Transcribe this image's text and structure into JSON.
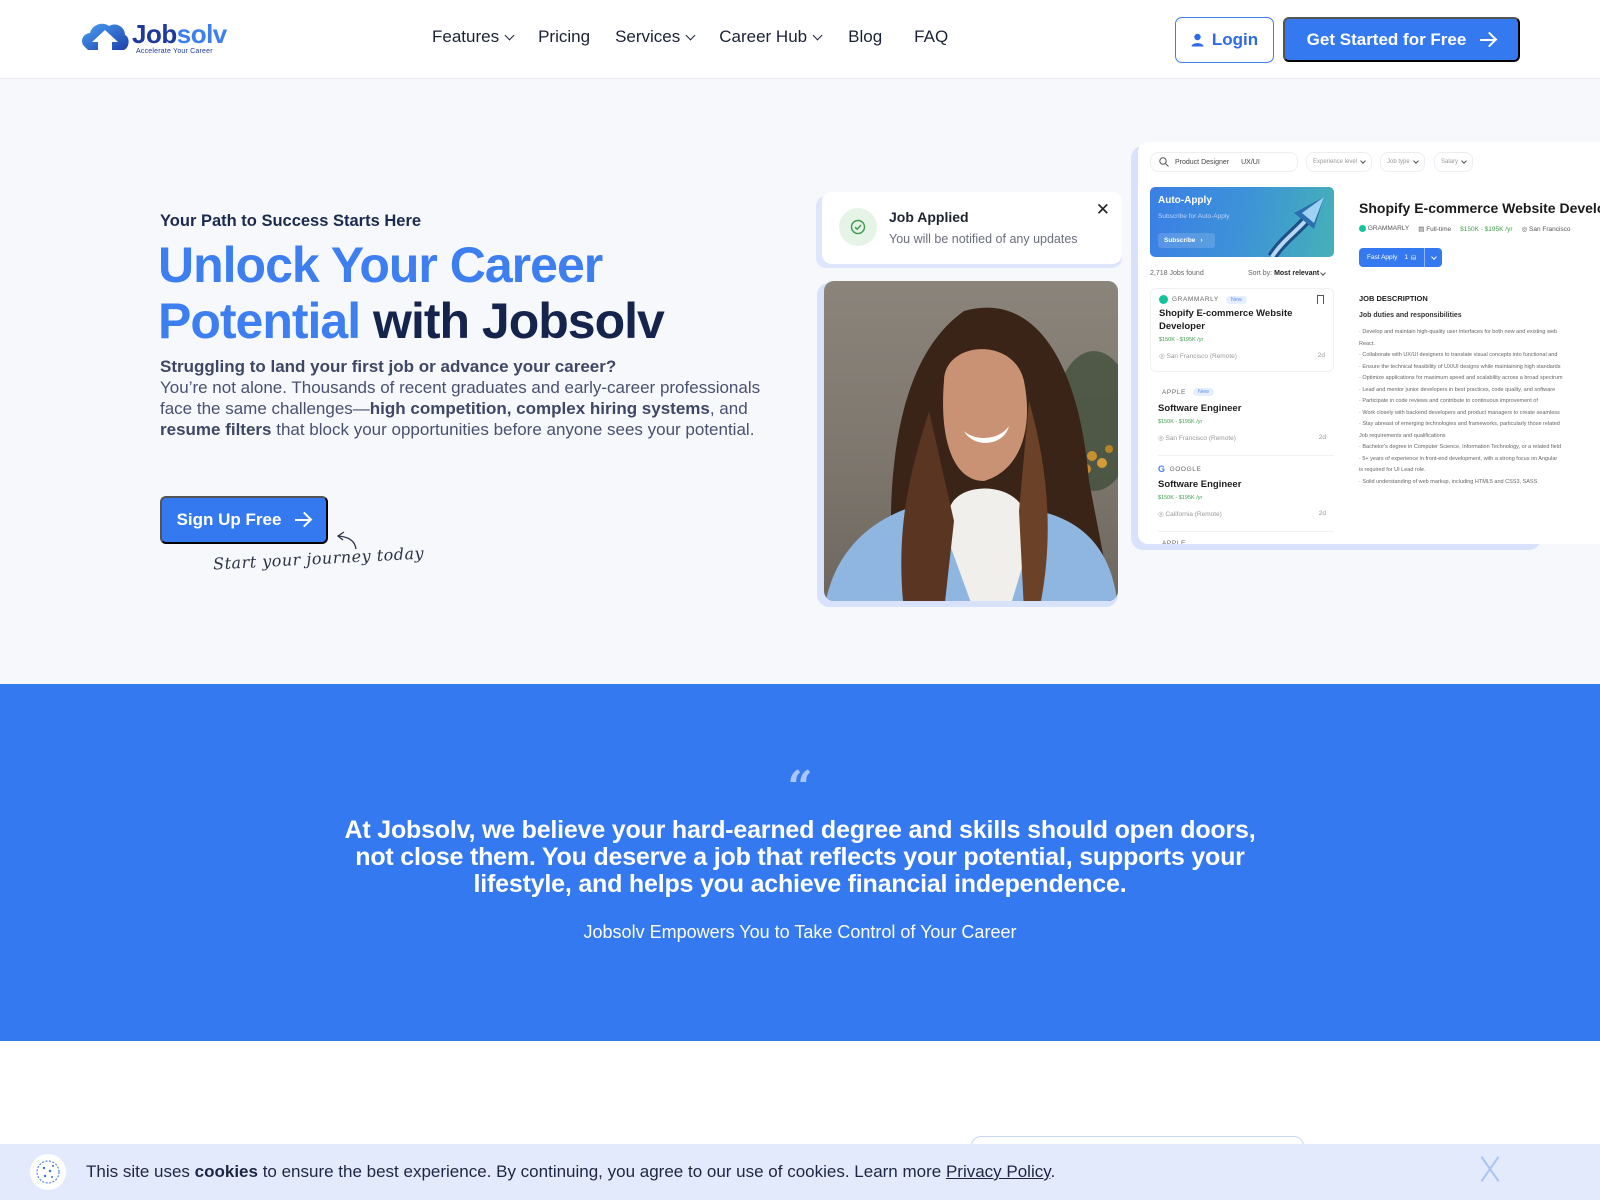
{
  "header": {
    "logo": {
      "word_part1": "Job",
      "word_part2": "solv",
      "tagline": "Accelerate Your Career"
    },
    "nav": [
      {
        "label": "Features",
        "has_dropdown": true
      },
      {
        "label": "Pricing",
        "has_dropdown": false
      },
      {
        "label": "Services",
        "has_dropdown": true
      },
      {
        "label": "Career Hub",
        "has_dropdown": true
      },
      {
        "label": "Blog",
        "has_dropdown": false
      },
      {
        "label": "FAQ",
        "has_dropdown": false
      }
    ],
    "login_label": "Login",
    "cta_label": "Get Started for Free"
  },
  "hero": {
    "eyebrow": "Your Path to Success Starts Here",
    "headline_blue": "Unlock Your Career Potential",
    "headline_dark": "with Jobsolv",
    "body_lead": "Struggling to land your first job or advance your career?",
    "body_part1": "You’re not alone. Thousands of recent graduates and early-career professionals face the same challenges—",
    "body_bold1": "high competition, complex hiring systems",
    "body_part2": ", and ",
    "body_bold2": "resume filters",
    "body_part3": " that block your opportunities before anyone sees your potential.",
    "signup_label": "Sign Up Free",
    "handwritten_note": "Start your journey today"
  },
  "notification": {
    "title": "Job Applied",
    "message": "You will be notified of any updates",
    "close": "✕"
  },
  "app_mock": {
    "search": {
      "keyword": "Product Designer",
      "tag": "UX/UI"
    },
    "filters": [
      "Experience level",
      "Job type",
      "Salary"
    ],
    "auto_apply": {
      "title": "Auto-Apply",
      "subtitle": "Subscribe for Auto-Apply",
      "button": "Subscribe"
    },
    "jobs_found": "2,718 Jobs found",
    "sort_label": "Sort by:",
    "sort_value": "Most relevant",
    "jobs": [
      {
        "company": "GRAMMARLY",
        "badge": "New",
        "title": "Shopify E-commerce Website Developer",
        "salary": "$150K - $195K /yr",
        "location": "San Francisco (Remote)",
        "age": "2d"
      },
      {
        "company": "APPLE",
        "badge": "New",
        "title": "Software Engineer",
        "salary": "$150K - $195K /yr",
        "location": "San Francisco (Remote)",
        "age": "2d"
      },
      {
        "company": "GOOGLE",
        "badge": "",
        "title": "Software Engineer",
        "salary": "$150K - $195K /yr",
        "location": "California (Remote)",
        "age": "2d"
      },
      {
        "company": "APPLE",
        "badge": "",
        "title": "",
        "salary": "",
        "location": "",
        "age": ""
      }
    ],
    "detail": {
      "title": "Shopify E-commerce Website Developer",
      "company": "GRAMMARLY",
      "job_type": "Full-time",
      "salary": "$150K - $195K /yr",
      "location": "San Francisco",
      "fast_apply_label": "Fast Apply",
      "fast_apply_count": "1",
      "section_title": "JOB DESCRIPTION",
      "subsection_title": "Job duties and responsibilities",
      "lines": [
        "· Develop and maintain high-quality user interfaces for both new and existing web",
        "React.",
        "· Collaborate with UX/UI designers to translate visual concepts into functional and",
        "· Ensure the technical feasibility of UX/UI designs while maintaining high standards",
        "· Optimize applications for maximum speed and scalability across a broad spectrum",
        "· Lead and mentor junior developers in best practices, code quality, and software",
        "· Participate in code reviews and contribute to continuous improvement of",
        "· Work closely with backend developers and product managers to create seamless",
        "· Stay abreast of emerging technologies and frameworks, particularly those related",
        "Job requirements and qualifications",
        "· Bachelor's degree in Computer Science, Information Technology, or a related field",
        "· 5+ years of experience in front-end development, with a strong focus on Angular",
        "is required for UI Lead role.",
        "· Solid understanding of web markup, including HTML5 and CSS3, SASS."
      ]
    }
  },
  "quote": {
    "mark": "“",
    "text": "At Jobsolv, we believe your hard-earned degree and skills should open doors, not close them. You deserve a job that reflects your potential, supports your lifestyle, and helps you achieve financial independence.",
    "subtext": "Jobsolv Empowers You to Take Control of Your Career"
  },
  "cookie_bar": {
    "text_before": "This site uses ",
    "text_bold": "cookies",
    "text_after": " to ensure the best experience. By continuing, you agree to our use of cookies. Learn more ",
    "link_label": "Privacy Policy",
    "text_end": "."
  },
  "colors": {
    "brand_blue": "#3579f0",
    "headline_blue": "#3d7ff0",
    "dark_navy": "#15244d",
    "salary_green": "#3fa04a",
    "cookie_bg": "#e3eafb"
  }
}
